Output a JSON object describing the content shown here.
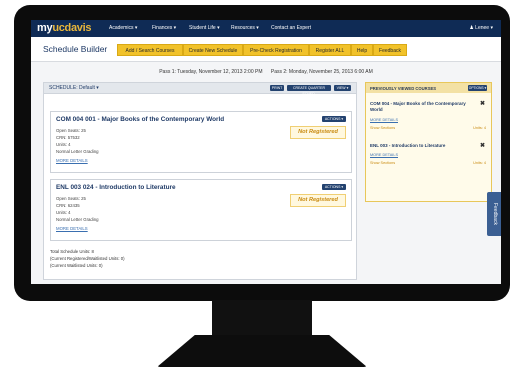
{
  "nav": {
    "logo_my": "my",
    "logo_ucdavis": "ucdavis",
    "items": [
      "Academics ▾",
      "Finances ▾",
      "Student Life ▾",
      "Resources ▾",
      "Contact an Expert"
    ],
    "user": "♟ Lenee ▾"
  },
  "header": {
    "app_name": "Schedule Builder",
    "tabs": [
      "Add / Search Courses",
      "Create New Schedule",
      "Pre-Check Registration",
      "Register ALL",
      "Help",
      "Feedback"
    ]
  },
  "pass_times": {
    "pass1": "Pass 1: Tuesday, November 12, 2013 2:00 PM",
    "pass2": "Pass 2: Monday, November 25, 2013 6:00 AM"
  },
  "schedule": {
    "label": "SCHEDULE: Default ▾",
    "buttons": [
      "PRINT",
      "CREATE QUARTER SCHED.",
      "VIEW ▾"
    ],
    "courses": [
      {
        "title": "COM 004 001 - Major Books of the Contemporary World",
        "open_seats": "Open Seats: 25",
        "crn": "CRN: 57532",
        "units": "Units: 4",
        "grading": "Normal Letter Grading",
        "details_link": "MORE DETAILS",
        "actions_label": "ACTIONS ▾",
        "status": "Not Registered"
      },
      {
        "title": "ENL 003 024 - Introduction to Literature",
        "open_seats": "Open Seats: 25",
        "crn": "CRN: 62435",
        "units": "Units: 4",
        "grading": "Normal Letter Grading",
        "details_link": "MORE DETAILS",
        "actions_label": "ACTIONS ▾",
        "status": "Not Registered"
      }
    ],
    "totals": [
      "Total Schedule Units: 8",
      "(Current Registered/Waitlisted Units: 0)",
      "(Current Waitlisted Units: 0)"
    ]
  },
  "previously_viewed": {
    "title": "PREVIOUSLY VIEWED COURSES",
    "button": "OPTIONS ▾",
    "items": [
      {
        "title": "COM 004 - Major Books of the Contemporary World",
        "link": "MORE DETAILS",
        "more": "Show Sections",
        "units": "Units: 4",
        "close": "✖"
      },
      {
        "title": "ENL 003 - Introduction to Literature",
        "link": "MORE DETAILS",
        "more": "Show Sections",
        "units": "Units: 4",
        "close": "✖"
      }
    ]
  },
  "feedback_tab": "Feedback"
}
